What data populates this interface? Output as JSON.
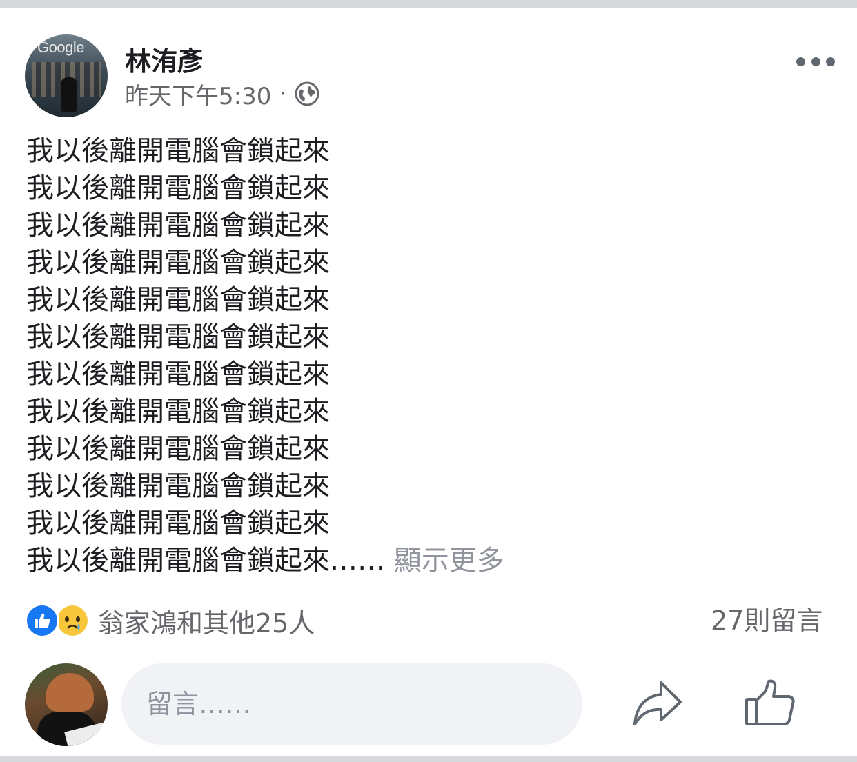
{
  "post": {
    "author_name": "林洧彥",
    "timestamp": "昨天下午5:30",
    "meta_separator": "·",
    "privacy_icon": "globe-icon",
    "avatar_logo_text": "Google",
    "body_lines": [
      "我以後離開電腦會鎖起來",
      "我以後離開電腦會鎖起來",
      "我以後離開電腦會鎖起來",
      "我以後離開電腦會鎖起來",
      "我以後離開電腦會鎖起來",
      "我以後離開電腦會鎖起來",
      "我以後離開電腦會鎖起來",
      "我以後離開電腦會鎖起來",
      "我以後離開電腦會鎖起來",
      "我以後離開電腦會鎖起來",
      "我以後離開電腦會鎖起來"
    ],
    "last_line": "我以後離開電腦會鎖起來……",
    "see_more_label": "顯示更多"
  },
  "reactions": {
    "types": [
      "like",
      "sad"
    ],
    "summary": "翁家鴻和其他25人",
    "comment_count_label": "27則留言"
  },
  "comment_box": {
    "placeholder": "留言……"
  },
  "actions": {
    "share_icon": "share-icon",
    "like_icon": "thumbs-up-icon"
  },
  "colors": {
    "like_blue": "#1877f2",
    "secondary_text": "#65676b",
    "see_more": "#90949c",
    "input_bg": "#f0f2f5",
    "separator": "#d7d9dd"
  }
}
